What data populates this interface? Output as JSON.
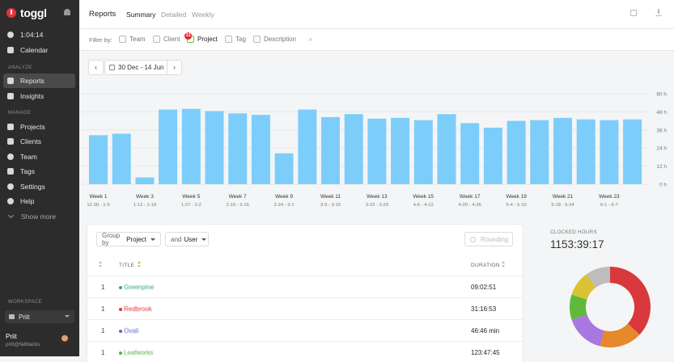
{
  "brand": {
    "name": "toggl"
  },
  "sidebar": {
    "timer": "1:04:14",
    "calendar": "Calendar",
    "analyze_label": "ANALYZE",
    "reports": "Reports",
    "insights": "Insights",
    "manage_label": "MANAGE",
    "projects": "Projects",
    "clients": "Clients",
    "team": "Team",
    "tags": "Tags",
    "settings": "Settings",
    "help": "Help",
    "show_more": "Show more",
    "workspace_label": "WORKSPACE",
    "workspace": "Priit",
    "user_name": "Priit",
    "user_email": "priit@fallbacks"
  },
  "header": {
    "title": "Reports",
    "tabs": [
      "Summary",
      "Detailed",
      "Weekly"
    ],
    "active_tab": "Summary"
  },
  "filter": {
    "label": "Filter by:",
    "items": [
      "Team",
      "Client",
      "Project",
      "Tag",
      "Description"
    ],
    "project_badge": "11",
    "clear": "×"
  },
  "date": {
    "prev": "‹",
    "range": "30 Dec - 14 Jun",
    "next": "›"
  },
  "chart_data": {
    "type": "bar",
    "color": "#7dcdfb",
    "weeks": [
      1,
      2,
      3,
      4,
      5,
      6,
      7,
      8,
      9,
      10,
      11,
      12,
      13,
      14,
      15,
      16,
      17,
      18,
      19,
      20,
      21,
      22,
      23,
      24
    ],
    "values": [
      32.5,
      33.5,
      4.5,
      49.5,
      50,
      48.5,
      47,
      46,
      20.5,
      49.5,
      44.5,
      46.5,
      43.5,
      44,
      42.5,
      46.5,
      40.5,
      37.5,
      42,
      42.5,
      44,
      43,
      42.5,
      43
    ],
    "tick_labels": [
      {
        "week": 1,
        "line1": "Week 1",
        "line2": "12-30 - 1-5"
      },
      {
        "week": 3,
        "line1": "Week 3",
        "line2": "1-13 - 1-19"
      },
      {
        "week": 5,
        "line1": "Week 5",
        "line2": "1-27 - 2-2"
      },
      {
        "week": 7,
        "line1": "Week 7",
        "line2": "2-10 - 2-16"
      },
      {
        "week": 9,
        "line1": "Week 9",
        "line2": "2-24 - 3-1"
      },
      {
        "week": 11,
        "line1": "Week 11",
        "line2": "3-9 - 3-15"
      },
      {
        "week": 13,
        "line1": "Week 13",
        "line2": "3-23 - 3-29"
      },
      {
        "week": 15,
        "line1": "Week 15",
        "line2": "4-6 - 4-12"
      },
      {
        "week": 17,
        "line1": "Week 17",
        "line2": "4-20 - 4-26"
      },
      {
        "week": 19,
        "line1": "Week 19",
        "line2": "5-4 - 5-10"
      },
      {
        "week": 21,
        "line1": "Week 21",
        "line2": "5-18 - 5-24"
      },
      {
        "week": 23,
        "line1": "Week 23",
        "line2": "6-1 - 6-7"
      }
    ],
    "y_ticks": [
      "0 h",
      "12 h",
      "24 h",
      "36 h",
      "48 h",
      "60 h"
    ],
    "ylim": [
      0,
      60
    ],
    "grid": true
  },
  "table": {
    "group_by_label": "Group by",
    "group_by_value": "Project",
    "and_label": "and",
    "and_value": "User",
    "rounding": "Rounding",
    "col_title": "TITLE",
    "col_duration": "DURATION",
    "rows": [
      {
        "num": "1",
        "title": "Greenpine",
        "color": "#2da58a",
        "duration": "09:02:51"
      },
      {
        "num": "1",
        "title": "Redbrook",
        "color": "#d9393d",
        "duration": "31:16:53"
      },
      {
        "num": "1",
        "title": "Ovali",
        "color": "#5b67c8",
        "duration": "46:46 min"
      },
      {
        "num": "1",
        "title": "Leafworks",
        "color": "#55b33b",
        "duration": "123:47:45"
      }
    ]
  },
  "summary": {
    "label": "CLOCKED HOURS",
    "value": "1153:39:17",
    "donut": [
      {
        "color": "#d9393d",
        "value": 37
      },
      {
        "color": "#e5892a",
        "value": 17
      },
      {
        "color": "#a977e0",
        "value": 16
      },
      {
        "color": "#5fba3b",
        "value": 10
      },
      {
        "color": "#d9c236",
        "value": 10
      },
      {
        "color": "#bdbdbd",
        "value": 10
      }
    ]
  }
}
